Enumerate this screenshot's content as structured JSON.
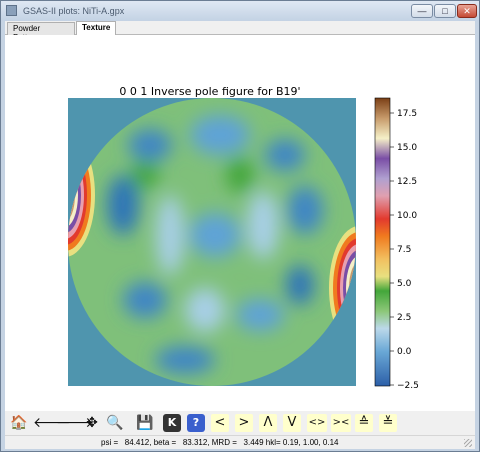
{
  "window": {
    "title": "GSAS-II plots: NiTi-A.gpx",
    "minimize": "—",
    "maximize": "□",
    "close": "✕"
  },
  "tabs": [
    {
      "label": "Powder Patterns",
      "active": false
    },
    {
      "label": "Texture",
      "active": true
    }
  ],
  "plot": {
    "title": "0 0 1 Inverse pole figure for B19'",
    "colorbar_ticks": [
      "17.5",
      "15.0",
      "12.5",
      "10.0",
      "7.5",
      "5.0",
      "2.5",
      "0.0",
      "−2.5"
    ],
    "colormap_colors": [
      "#2c5fa8",
      "#6aa8d6",
      "#bcd9ea",
      "#8cc778",
      "#43a63a",
      "#e8e080",
      "#f2a64a",
      "#f07a1f",
      "#e23a2e",
      "#b0a0d0",
      "#7a4ea6",
      "#c79a6a",
      "#7b3f16"
    ],
    "background_color": "#4f95ae"
  },
  "toolbar": {
    "home": "🏠",
    "back": "🡐",
    "forward": "🡒",
    "pan": "✥",
    "zoom": "🔍",
    "save": "💾",
    "key": "K",
    "help": "?",
    "lt": "<",
    "gt": ">",
    "up": "Λ",
    "down": "V",
    "wide": "<>",
    "narrow": "><",
    "vwide": "≙",
    "vnarrow": "≚"
  },
  "status": {
    "text": "psi =   84.412, beta =   83.312, MRD =   3.449 hkl= 0.19, 1.00, 0.14"
  }
}
